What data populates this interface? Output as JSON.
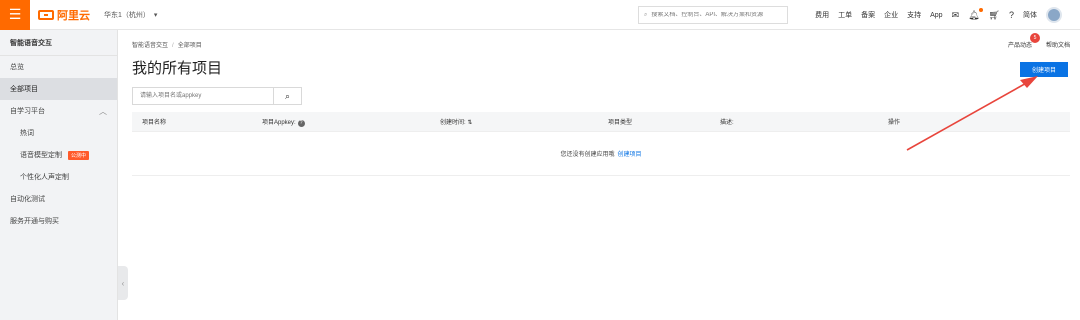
{
  "topbar": {
    "menu_icon": "☰",
    "logo_text": "阿里云",
    "region": "华东1（杭州）",
    "search_placeholder": "搜索文档、控制台、API、解决方案和资源",
    "links": [
      "费用",
      "工单",
      "备案",
      "企业",
      "支持",
      "App"
    ],
    "lang": "简体"
  },
  "sidebar": {
    "title": "智能语音交互",
    "items": [
      {
        "label": "总览"
      },
      {
        "label": "全部项目"
      },
      {
        "label": "自学习平台"
      },
      {
        "label": "热词"
      },
      {
        "label": "语音模型定制",
        "tag": "公测中"
      },
      {
        "label": "个性化人声定制"
      },
      {
        "label": "自动化测试"
      },
      {
        "label": "服务开通与购买"
      }
    ]
  },
  "main": {
    "breadcrumb": [
      "智能语音交互",
      "全部项目"
    ],
    "title": "我的所有项目",
    "product_updates": "产品动态",
    "product_updates_badge": "5",
    "help_docs": "帮助文档",
    "create_button": "创建项目",
    "filter_placeholder": "请输入项目名或appkey",
    "columns": [
      "项目名称",
      "项目Appkey:",
      "创建时间:",
      "项目类型",
      "描述:",
      "操作"
    ],
    "empty_text": "您还没有创建应用哦",
    "empty_link": "创建项目"
  },
  "colors": {
    "brand": "#ff6a00",
    "primary": "#0a73e4",
    "annotation": "#e8453c"
  }
}
